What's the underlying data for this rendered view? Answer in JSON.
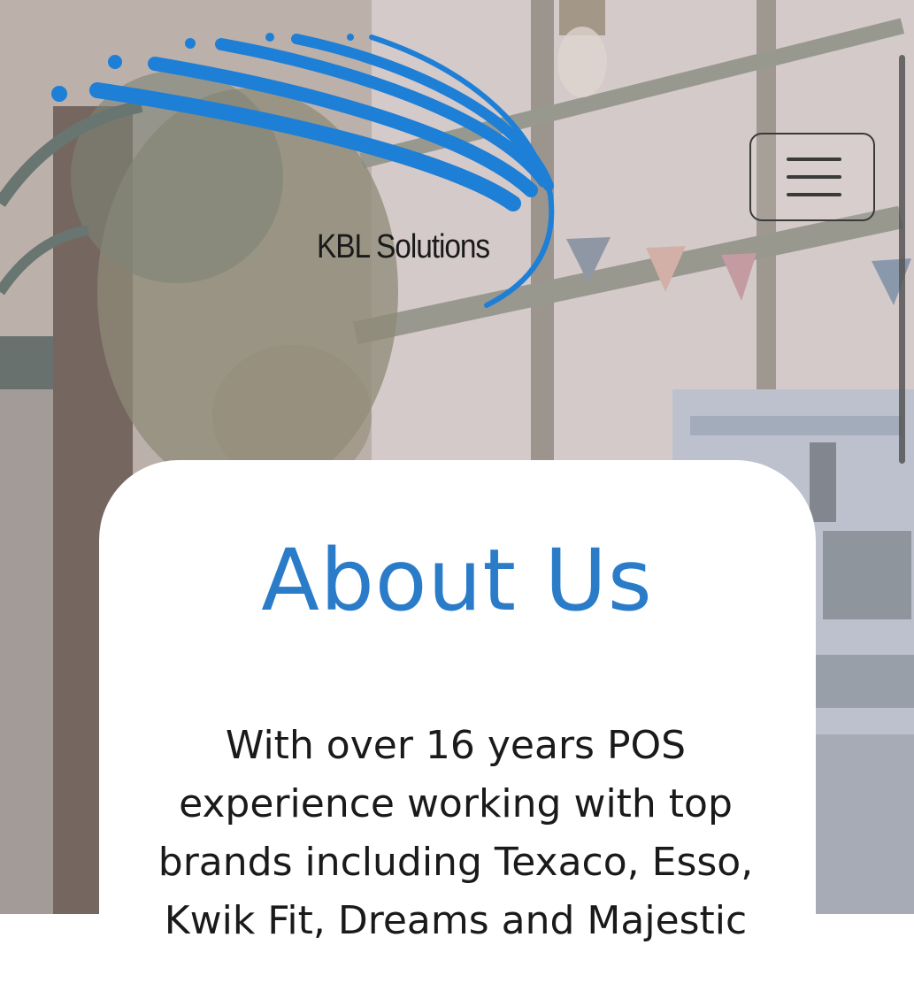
{
  "brand": {
    "name": "KBL Solutions",
    "accent_color": "#1e7fd6"
  },
  "header": {
    "menu_icon": "hamburger-menu-icon"
  },
  "about": {
    "title": "About Us",
    "title_color": "#2a7cc9",
    "text": "With over 16 years POS experience working with top brands including Texaco, Esso, Kwik Fit, Dreams and Majestic"
  }
}
